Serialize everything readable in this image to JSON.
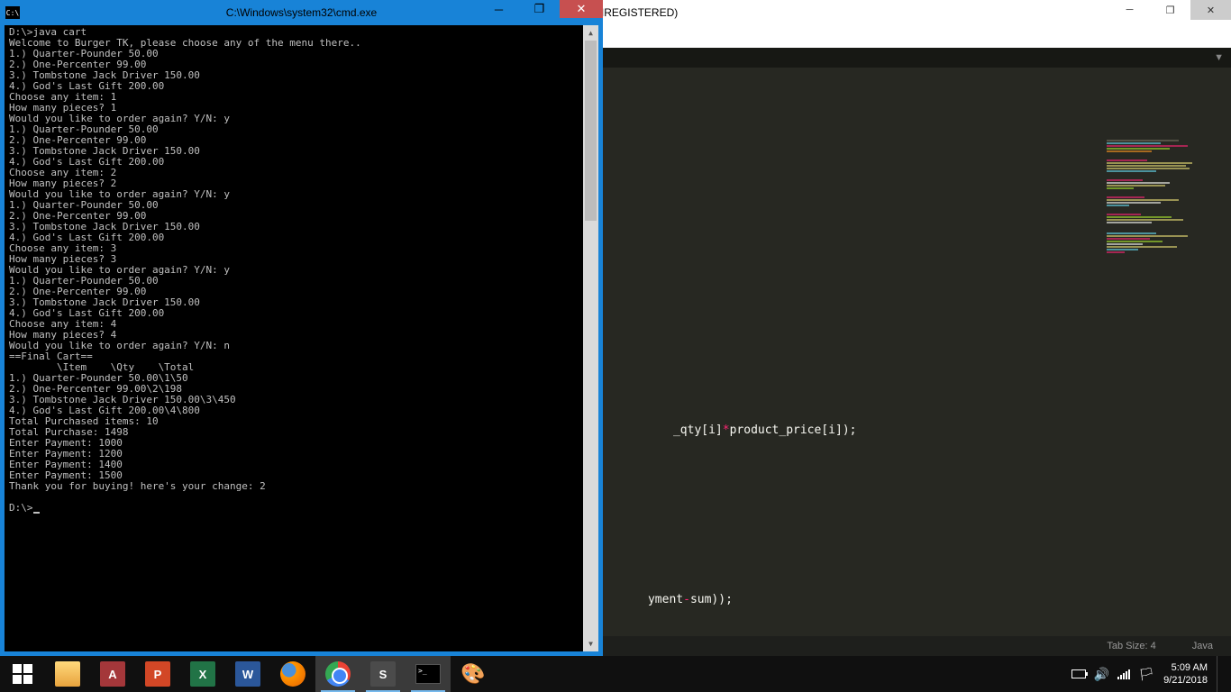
{
  "sublime": {
    "title": "e Text (UNREGISTERED)",
    "status_tab": "Tab Size: 4",
    "status_lang": "Java",
    "code1_a": "_qty[i]",
    "code1_b": "*",
    "code1_c": "product_price[i]);",
    "code2_a": "yment",
    "code2_b": "-",
    "code2_c": "sum));"
  },
  "cmd": {
    "title": "C:\\Windows\\system32\\cmd.exe",
    "lines": [
      "D:\\>java cart",
      "Welcome to Burger TK, please choose any of the menu there..",
      "1.) Quarter-Pounder 50.00",
      "2.) One-Percenter 99.00",
      "3.) Tombstone Jack Driver 150.00",
      "4.) God's Last Gift 200.00",
      "Choose any item: 1",
      "How many pieces? 1",
      "Would you like to order again? Y/N: y",
      "1.) Quarter-Pounder 50.00",
      "2.) One-Percenter 99.00",
      "3.) Tombstone Jack Driver 150.00",
      "4.) God's Last Gift 200.00",
      "Choose any item: 2",
      "How many pieces? 2",
      "Would you like to order again? Y/N: y",
      "1.) Quarter-Pounder 50.00",
      "2.) One-Percenter 99.00",
      "3.) Tombstone Jack Driver 150.00",
      "4.) God's Last Gift 200.00",
      "Choose any item: 3",
      "How many pieces? 3",
      "Would you like to order again? Y/N: y",
      "1.) Quarter-Pounder 50.00",
      "2.) One-Percenter 99.00",
      "3.) Tombstone Jack Driver 150.00",
      "4.) God's Last Gift 200.00",
      "Choose any item: 4",
      "How many pieces? 4",
      "Would you like to order again? Y/N: n",
      "==Final Cart==",
      "        \\Item    \\Qty    \\Total",
      "1.) Quarter-Pounder 50.00\\1\\50",
      "2.) One-Percenter 99.00\\2\\198",
      "3.) Tombstone Jack Driver 150.00\\3\\450",
      "4.) God's Last Gift 200.00\\4\\800",
      "Total Purchased items: 10",
      "Total Purchase: 1498",
      "Enter Payment: 1000",
      "Enter Payment: 1200",
      "Enter Payment: 1400",
      "Enter Payment: 1500",
      "Thank you for buying! here's your change: 2",
      "",
      "D:\\>"
    ]
  },
  "tray": {
    "time": "5:09 AM",
    "date": "9/21/2018"
  },
  "taskbar": {
    "access": "A",
    "ppt": "P",
    "excel": "X",
    "word": "W",
    "sublime": "S",
    "cmd": ">_",
    "paint": "🎨"
  }
}
